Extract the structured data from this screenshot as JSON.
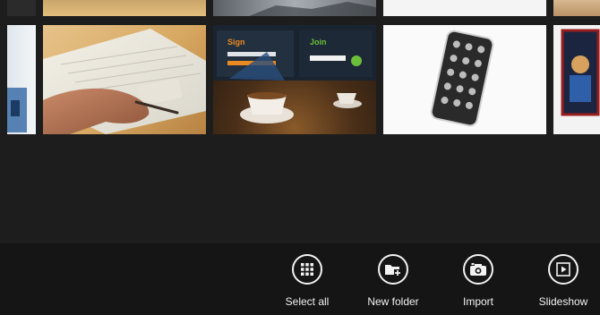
{
  "gallery": {
    "tiles": [
      {
        "name": "tile-top-partial-1"
      },
      {
        "name": "tile-top-partial-2"
      },
      {
        "name": "tile-top-partial-3"
      },
      {
        "name": "tile-top-partial-4"
      },
      {
        "name": "tile-top-partial-5"
      },
      {
        "name": "tile-laptop-hand",
        "description_icon": "photo"
      },
      {
        "name": "tile-website-cafe",
        "description_icon": "photo"
      },
      {
        "name": "tile-phone-case",
        "description_icon": "photo"
      },
      {
        "name": "tile-poster-partial",
        "description_icon": "photo"
      }
    ]
  },
  "cafe_screen": {
    "left_heading": "Sign",
    "right_heading": "Join"
  },
  "app_bar": {
    "commands": [
      {
        "id": "select_all",
        "label": "Select all",
        "icon": "grid-icon"
      },
      {
        "id": "new_folder",
        "label": "New folder",
        "icon": "folder-add-icon"
      },
      {
        "id": "import",
        "label": "Import",
        "icon": "camera-import-icon"
      },
      {
        "id": "slideshow",
        "label": "Slideshow",
        "icon": "play-icon"
      }
    ]
  },
  "colors": {
    "background": "#1e1e1e",
    "app_bar": "#151515",
    "icon_stroke": "#f2f2f2",
    "accent_orange": "#e98a22",
    "accent_green": "#6bbf3a"
  }
}
